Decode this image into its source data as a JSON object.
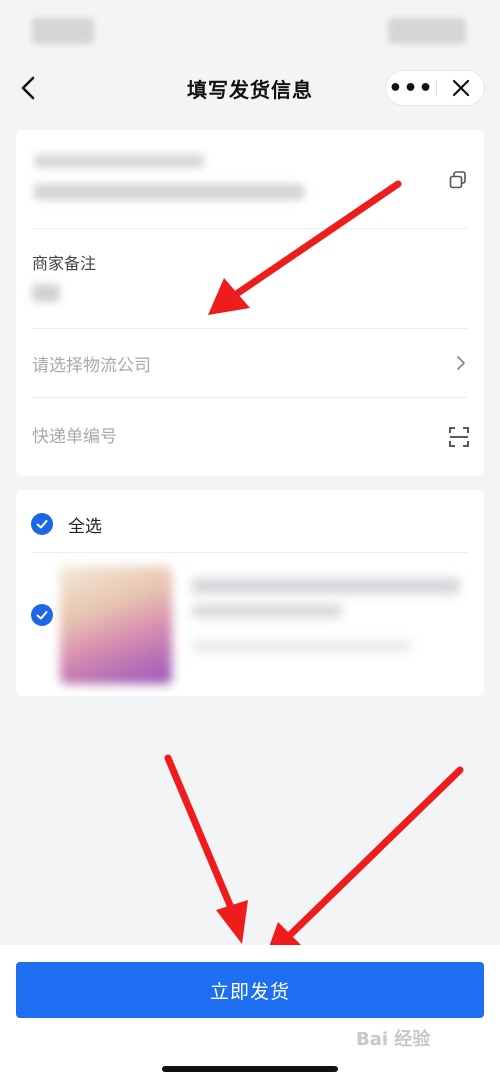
{
  "nav": {
    "title": "填写发货信息",
    "more_label": "•••"
  },
  "form": {
    "merchant_note_label": "商家备注",
    "logistics_placeholder": "请选择物流公司",
    "tracking_placeholder": "快递单编号"
  },
  "items": {
    "select_all_label": "全选",
    "select_all_checked": true,
    "product_checked": true
  },
  "action": {
    "ship_button_label": "立即发货"
  },
  "watermark": {
    "text": "Bai 经验"
  },
  "colors": {
    "accent": "#1d6ef0",
    "checkbox": "#1e66e8",
    "annotation_arrow": "#ee1c1c"
  },
  "icons": [
    "back-icon",
    "more-icon",
    "close-icon",
    "copy-icon",
    "chevron-right-icon",
    "scan-icon",
    "check-icon"
  ]
}
